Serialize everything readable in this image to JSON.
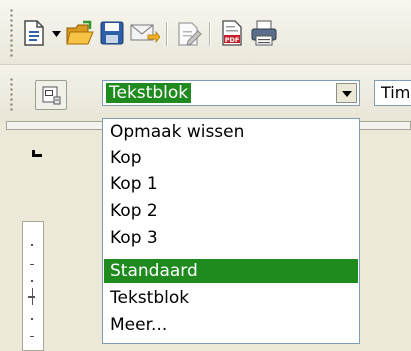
{
  "toolbar": {
    "icons": [
      "new-document-icon",
      "dropdown-arrow-icon",
      "open-folder-icon",
      "save-icon",
      "email-icon",
      "edit-file-icon",
      "export-pdf-icon",
      "print-icon"
    ]
  },
  "format_toolbar": {
    "styles_button_icon": "styles-formatting-icon",
    "paragraph_style": "Tekstblok",
    "font_name": "Tim"
  },
  "style_dropdown": {
    "selected": "Standaard",
    "items": [
      "Opmaak wissen",
      "Kop",
      "Kop 1",
      "Kop 2",
      "Kop 3",
      "Standaard",
      "Tekstblok",
      "Meer..."
    ]
  },
  "colors": {
    "selection": "#1f8b1f",
    "toolbar_bg": "#ece9d8",
    "border": "#7f9db9"
  }
}
